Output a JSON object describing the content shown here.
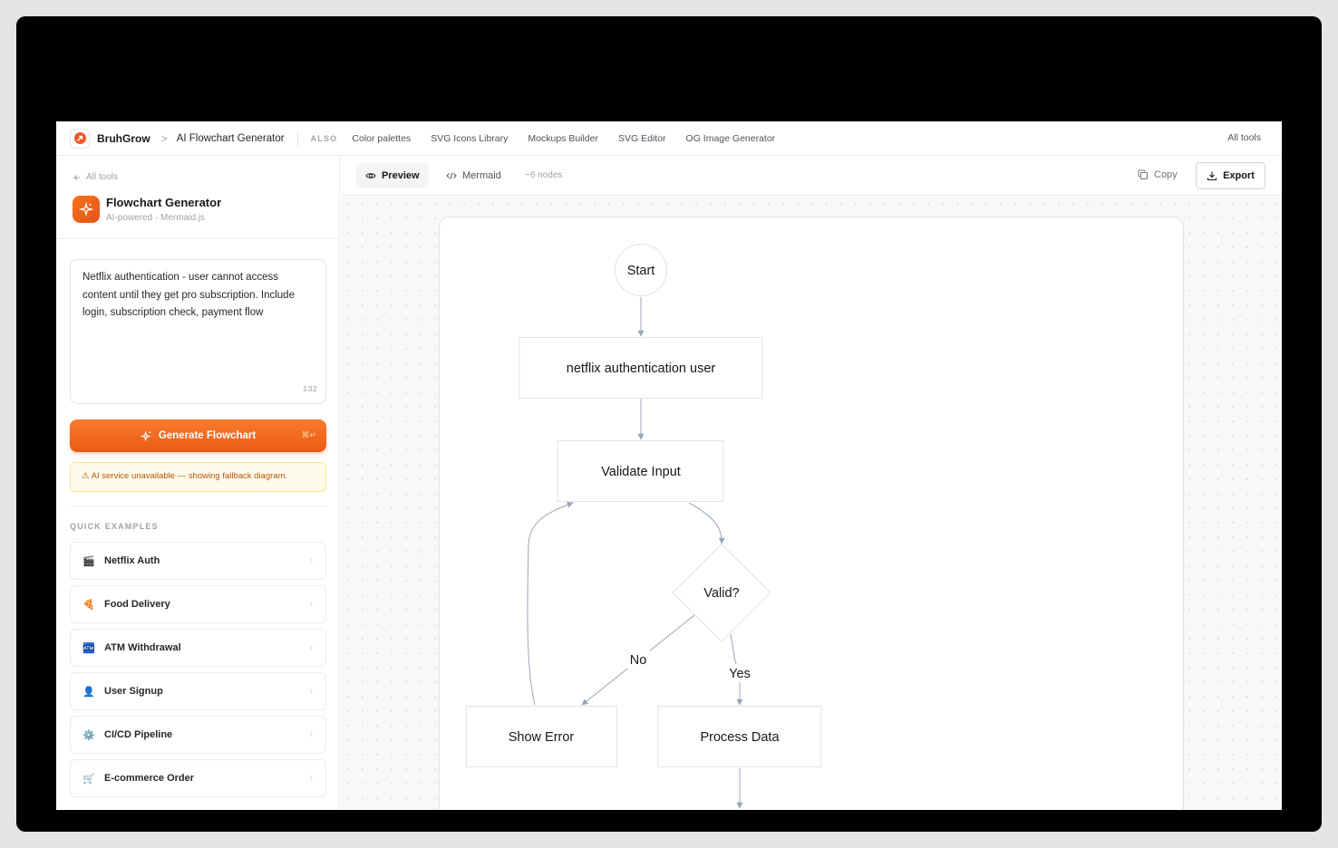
{
  "nav": {
    "brand": "BruhGrow",
    "separator": ">",
    "current": "AI Flowchart Generator",
    "also_label": "ALSO",
    "links": [
      "Color palettes",
      "SVG Icons Library",
      "Mockups Builder",
      "SVG Editor",
      "OG Image Generator"
    ],
    "all_tools": "All tools"
  },
  "sidebar": {
    "back_label": "All tools",
    "tool_title": "Flowchart Generator",
    "tool_subtitle": "AI-powered · Mermaid.js",
    "prompt_value": "Netflix authentication - user cannot access content until they get pro subscription. Include login, subscription check, payment flow",
    "char_count": "132",
    "generate_label": "Generate Flowchart",
    "shortcut": "⌘↵",
    "warning": "⚠ AI service unavailable — showing fallback diagram.",
    "examples_label": "QUICK EXAMPLES",
    "examples": [
      {
        "emoji": "🎬",
        "label": "Netflix Auth"
      },
      {
        "emoji": "🍕",
        "label": "Food Delivery"
      },
      {
        "emoji": "🏧",
        "label": "ATM Withdrawal"
      },
      {
        "emoji": "👤",
        "label": "User Signup"
      },
      {
        "emoji": "⚙️",
        "label": "CI/CD Pipeline"
      },
      {
        "emoji": "🛒",
        "label": "E-commerce Order"
      }
    ]
  },
  "main": {
    "tabs": [
      {
        "label": "Preview",
        "icon": "eye-icon",
        "active": true
      },
      {
        "label": "Mermaid",
        "icon": "code-icon",
        "active": false
      }
    ],
    "node_count": "~6 nodes",
    "copy_label": "Copy",
    "export_label": "Export"
  },
  "flowchart": {
    "nodes": {
      "start": "Start",
      "auth": "netflix authentication user",
      "validate": "Validate Input",
      "decision": "Valid?",
      "error": "Show Error",
      "process": "Process Data"
    },
    "edge_labels": {
      "no": "No",
      "yes": "Yes"
    }
  },
  "colors": {
    "accent": "#f97316",
    "edge": "#9aa5b8",
    "warning_bg": "#fffbeb",
    "warning_text": "#b45309"
  }
}
